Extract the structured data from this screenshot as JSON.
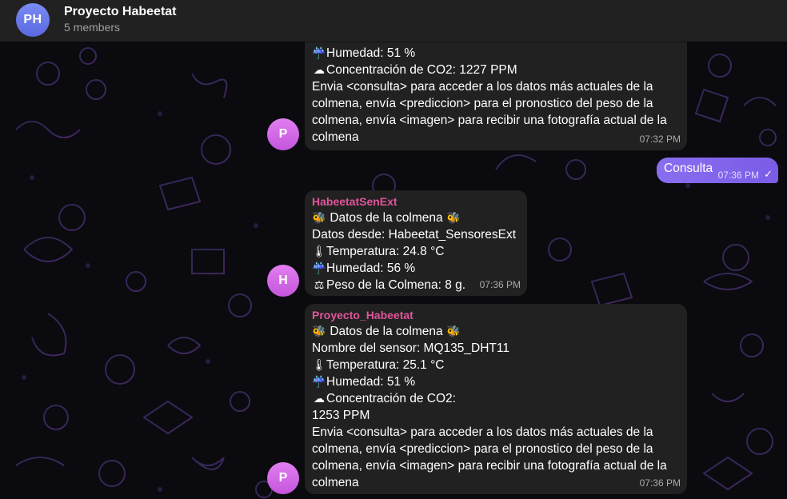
{
  "header": {
    "avatar_initials": "PH",
    "title": "Proyecto Habeetat",
    "subtitle": "5 members"
  },
  "messages": [
    {
      "avatar": "P",
      "lines": [
        "Humedad: 51 %",
        "Concentración de CO2: 1227 PPM",
        "Envia <consulta> para acceder a los datos más actuales de la",
        "colmena, envía <prediccion> para el pronostico del peso de la",
        "colmena, envía <imagen> para recibir una fotografía actual de la",
        "colmena"
      ],
      "time": "07:32 PM"
    },
    {
      "outgoing": true,
      "text": "Consulta",
      "time": "07:36 PM"
    },
    {
      "avatar": "H",
      "sender": "HabeetatSenExt",
      "lines": [
        "Datos de la colmena",
        "Datos desde: Habeetat_SensoresExt",
        "Temperatura: 24.8 °C",
        "Humedad: 56 %",
        "Peso de la Colmena: 8 g."
      ],
      "time": "07:36 PM"
    },
    {
      "avatar": "P",
      "sender": "Proyecto_Habeetat",
      "lines": [
        "Datos de la colmena",
        "Nombre del sensor: MQ135_DHT11",
        "Temperatura: 25.1 °C",
        "Humedad: 51 %",
        "Concentración de CO2:",
        "1253 PPM",
        "Envia <consulta> para acceder a los datos más actuales de la",
        "colmena, envía <prediccion> para el pronostico del peso de la",
        "colmena, envía <imagen> para recibir una fotografía actual de la",
        "colmena"
      ],
      "time": "07:36 PM"
    }
  ],
  "colors": {
    "header_bg": "#212121",
    "bubble_bg": "#212121",
    "outgoing_bubble": "#8a6ef0",
    "sender_name": "#e0559a",
    "avatar_p": "#d36be8",
    "avatar_ph": "#6b7cf0"
  },
  "icons": [
    "bee-icon",
    "thermometer-icon",
    "umbrella-rain-icon",
    "cloud-icon",
    "scale-icon",
    "double-check-icon"
  ]
}
